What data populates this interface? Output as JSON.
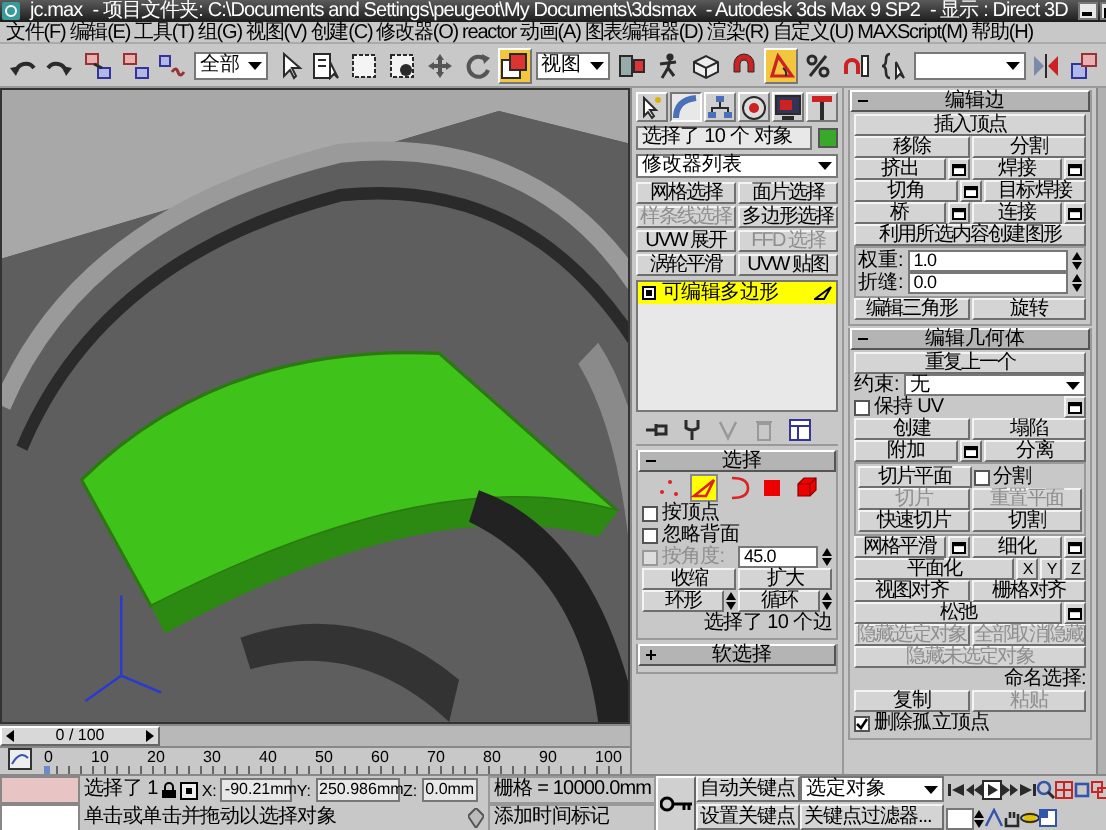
{
  "window": {
    "title_parts": [
      "jc.max",
      "- 项目文件夹: C:\\Documents and Settings\\peugeot\\My Documents\\3dsmax",
      "- Autodesk 3ds Max 9 SP2",
      "- 显示 : Direct 3D"
    ]
  },
  "menu": [
    "文件(F)",
    "编辑(E)",
    "工具(T)",
    "组(G)",
    "视图(V)",
    "创建(C)",
    "修改器(O)",
    "reactor",
    "动画(A)",
    "图表编辑器(D)",
    "渲染(R)",
    "自定义(U)",
    "MAXScript(M)",
    "帮助(H)"
  ],
  "toolbar": [
    {
      "kind": "button",
      "active": false
    },
    {
      "kind": "button",
      "active": false
    },
    {
      "kind": "button",
      "active": false
    },
    {
      "kind": "button",
      "active": false
    },
    {
      "kind": "button",
      "active": false
    },
    {
      "kind": "dropdown",
      "value": "全部"
    },
    {
      "kind": "button",
      "active": false
    },
    {
      "kind": "button",
      "active": false
    },
    {
      "kind": "button",
      "active": false
    },
    {
      "kind": "button",
      "active": false
    },
    {
      "kind": "button",
      "active": false
    },
    {
      "kind": "button",
      "active": false
    },
    {
      "kind": "button",
      "active": true
    },
    {
      "kind": "dropdown",
      "value": "视图"
    },
    {
      "kind": "button",
      "active": false
    },
    {
      "kind": "button",
      "active": false
    },
    {
      "kind": "button",
      "active": false
    },
    {
      "kind": "button",
      "active": false
    },
    {
      "kind": "button",
      "active": true
    },
    {
      "kind": "button",
      "active": false
    },
    {
      "kind": "button",
      "active": false
    },
    {
      "kind": "button",
      "active": false
    },
    {
      "kind": "dropdown"
    },
    {
      "kind": "button",
      "active": false
    },
    {
      "kind": "button",
      "active": false
    }
  ],
  "command_panel": {
    "tabs": [
      {
        "selected": false
      },
      {
        "selected": true
      },
      {
        "selected": false
      },
      {
        "selected": false
      },
      {
        "selected": false
      },
      {
        "selected": false
      }
    ],
    "object_name": "选择了 10 个 对象",
    "modifier_list": "修改器列表",
    "modifier_buttons": [
      {
        "label": "网格选择",
        "disabled": false
      },
      {
        "label": "面片选择",
        "disabled": false
      },
      {
        "label": "样条线选择",
        "disabled": true
      },
      {
        "label": "多边形选择",
        "disabled": false
      },
      {
        "label": "UVW 展开",
        "disabled": false
      },
      {
        "label": "FFD 选择",
        "disabled": true
      },
      {
        "label": "涡轮平滑",
        "disabled": false
      },
      {
        "label": "UVW 贴图",
        "disabled": false
      }
    ],
    "stack": [
      {
        "label": "可编辑多边形",
        "selected": true
      }
    ],
    "left_rollouts": [
      {
        "title": "选择",
        "expanded": true,
        "items": [
          {
            "kind": "levels",
            "levels": [
              {
                "selected": false
              },
              {
                "selected": true
              },
              {
                "selected": false
              },
              {
                "selected": false
              },
              {
                "selected": false
              }
            ]
          },
          {
            "kind": "row",
            "controls": [
              {
                "kind": "checkbox",
                "label": "按顶点",
                "checked": false,
                "disabled": false
              }
            ]
          },
          {
            "kind": "row",
            "controls": [
              {
                "kind": "checkbox",
                "label": "忽略背面",
                "checked": false,
                "disabled": false
              }
            ]
          },
          {
            "kind": "row",
            "controls": [
              {
                "kind": "checkbox",
                "label": "按角度:",
                "checked": false,
                "disabled": true
              },
              {
                "kind": "spinner",
                "value": "45.0"
              }
            ]
          },
          {
            "kind": "row",
            "controls": [
              {
                "kind": "button",
                "label": "收缩",
                "disabled": false
              },
              {
                "kind": "button",
                "label": "扩大",
                "disabled": false
              }
            ]
          },
          {
            "kind": "row",
            "controls": [
              {
                "kind": "spinbutton",
                "label": "环形",
                "disabled": false
              },
              {
                "kind": "spinbutton",
                "label": "循环",
                "disabled": false
              }
            ]
          },
          {
            "kind": "row",
            "controls": [
              {
                "kind": "text",
                "text": "选择了 10 个边"
              }
            ]
          }
        ]
      },
      {
        "title": "软选择",
        "expanded": false
      }
    ],
    "right_rollouts": [
      {
        "title": "编辑边",
        "expanded": true,
        "items": [
          {
            "kind": "row",
            "controls": [
              {
                "kind": "button",
                "label": "插入顶点",
                "disabled": false
              }
            ]
          },
          {
            "kind": "row",
            "controls": [
              {
                "kind": "button",
                "label": "移除",
                "disabled": false
              },
              {
                "kind": "button",
                "label": "分割",
                "disabled": false
              }
            ]
          },
          {
            "kind": "row",
            "controls": [
              {
                "kind": "button",
                "label": "挤出",
                "disabled": false
              },
              {
                "kind": "settings"
              },
              {
                "kind": "button",
                "label": "焊接",
                "disabled": false
              },
              {
                "kind": "settings"
              }
            ]
          },
          {
            "kind": "row",
            "controls": [
              {
                "kind": "button",
                "label": "切角",
                "disabled": false
              },
              {
                "kind": "settings"
              },
              {
                "kind": "button",
                "label": "目标焊接",
                "disabled": false
              }
            ]
          },
          {
            "kind": "row",
            "controls": [
              {
                "kind": "button",
                "label": "桥",
                "disabled": false
              },
              {
                "kind": "settings"
              },
              {
                "kind": "button",
                "label": "连接",
                "disabled": false
              },
              {
                "kind": "settings"
              }
            ]
          },
          {
            "kind": "row",
            "controls": [
              {
                "kind": "button",
                "label": "利用所选内容创建图形",
                "disabled": false
              }
            ]
          },
          {
            "kind": "group",
            "rows": [
              {
                "kind": "row",
                "controls": [
                  {
                    "kind": "spinner",
                    "label": "权重:",
                    "value": "1.0"
                  }
                ]
              },
              {
                "kind": "row",
                "controls": [
                  {
                    "kind": "spinner",
                    "label": "折缝:",
                    "value": "0.0"
                  }
                ]
              }
            ]
          },
          {
            "kind": "row",
            "controls": [
              {
                "kind": "button",
                "label": "编辑三角形",
                "disabled": false
              },
              {
                "kind": "button",
                "label": "旋转",
                "disabled": false
              }
            ]
          }
        ]
      },
      {
        "title": "编辑几何体",
        "expanded": true,
        "items": [
          {
            "kind": "row",
            "controls": [
              {
                "kind": "button",
                "label": "重复上一个",
                "disabled": false
              }
            ]
          },
          {
            "kind": "row",
            "controls": [
              {
                "kind": "dropdown",
                "label": "约束:",
                "value": "无"
              }
            ]
          },
          {
            "kind": "row",
            "controls": [
              {
                "kind": "checkbox",
                "label": "保持 UV",
                "checked": false,
                "disabled": false
              },
              {
                "kind": "settings"
              }
            ]
          },
          {
            "kind": "row",
            "controls": [
              {
                "kind": "button",
                "label": "创建",
                "disabled": false
              },
              {
                "kind": "button",
                "label": "塌陷",
                "disabled": false
              }
            ]
          },
          {
            "kind": "row",
            "controls": [
              {
                "kind": "button",
                "label": "附加",
                "disabled": false
              },
              {
                "kind": "settings"
              },
              {
                "kind": "button",
                "label": "分离",
                "disabled": false
              }
            ]
          },
          {
            "kind": "group",
            "rows": [
              {
                "kind": "row",
                "controls": [
                  {
                    "kind": "button",
                    "label": "切片平面",
                    "disabled": false
                  },
                  {
                    "kind": "checkbox",
                    "label": "分割",
                    "checked": false,
                    "disabled": false
                  }
                ]
              },
              {
                "kind": "row",
                "controls": [
                  {
                    "kind": "button",
                    "label": "切片",
                    "disabled": true
                  },
                  {
                    "kind": "button",
                    "label": "重置平面",
                    "disabled": true
                  }
                ]
              },
              {
                "kind": "row",
                "controls": [
                  {
                    "kind": "button",
                    "label": "快速切片",
                    "disabled": false
                  },
                  {
                    "kind": "button",
                    "label": "切割",
                    "disabled": false
                  }
                ]
              }
            ]
          },
          {
            "kind": "row",
            "controls": [
              {
                "kind": "button",
                "label": "网格平滑",
                "disabled": false
              },
              {
                "kind": "settings"
              },
              {
                "kind": "button",
                "label": "细化",
                "disabled": false
              },
              {
                "kind": "settings"
              }
            ]
          },
          {
            "kind": "row",
            "controls": [
              {
                "kind": "button",
                "label": "平面化",
                "disabled": false
              },
              {
                "kind": "small_button",
                "label": "X",
                "disabled": false
              },
              {
                "kind": "small_button",
                "label": "Y",
                "disabled": false
              },
              {
                "kind": "small_button",
                "label": "Z",
                "disabled": false
              }
            ]
          },
          {
            "kind": "row",
            "controls": [
              {
                "kind": "button",
                "label": "视图对齐",
                "disabled": false
              },
              {
                "kind": "button",
                "label": "栅格对齐",
                "disabled": false
              }
            ]
          },
          {
            "kind": "row",
            "controls": [
              {
                "kind": "button",
                "label": "松弛",
                "disabled": false
              },
              {
                "kind": "settings"
              }
            ]
          },
          {
            "kind": "row",
            "controls": [
              {
                "kind": "button",
                "label": "隐藏选定对象",
                "disabled": true
              },
              {
                "kind": "button",
                "label": "全部取消隐藏",
                "disabled": true
              }
            ]
          },
          {
            "kind": "row",
            "controls": [
              {
                "kind": "button",
                "label": "隐藏未选定对象",
                "disabled": true
              }
            ]
          },
          {
            "kind": "row",
            "controls": [
              {
                "kind": "text",
                "text": "命名选择:"
              }
            ]
          },
          {
            "kind": "row",
            "controls": [
              {
                "kind": "button",
                "label": "复制",
                "disabled": false
              },
              {
                "kind": "button",
                "label": "粘贴",
                "disabled": true
              }
            ]
          },
          {
            "kind": "row",
            "controls": [
              {
                "kind": "checkbox",
                "label": "删除孤立顶点",
                "checked": true,
                "disabled": false
              }
            ]
          }
        ]
      }
    ]
  },
  "time_slider": {
    "label": "0 / 100",
    "level": 0
  },
  "ruler": [
    "0",
    "10",
    "20",
    "30",
    "40",
    "50",
    "60",
    "70",
    "80",
    "90",
    "100"
  ],
  "status": {
    "selected_count": "选择了 1",
    "x": {
      "label": "X:",
      "value": "-90.21mm"
    },
    "y": {
      "label": "Y:",
      "value": "250.986mm"
    },
    "z": {
      "label": "Z:",
      "value": "0.0mm"
    },
    "grid": "栅格 = 10000.0mm",
    "prompt": "单击或单击并拖动以选择对象",
    "time_tag": "添加时间标记",
    "auto_key": "自动关键点",
    "key_mode": "选定对象",
    "set_key": "设置关键点",
    "key_filters": "关键点过滤器..."
  }
}
